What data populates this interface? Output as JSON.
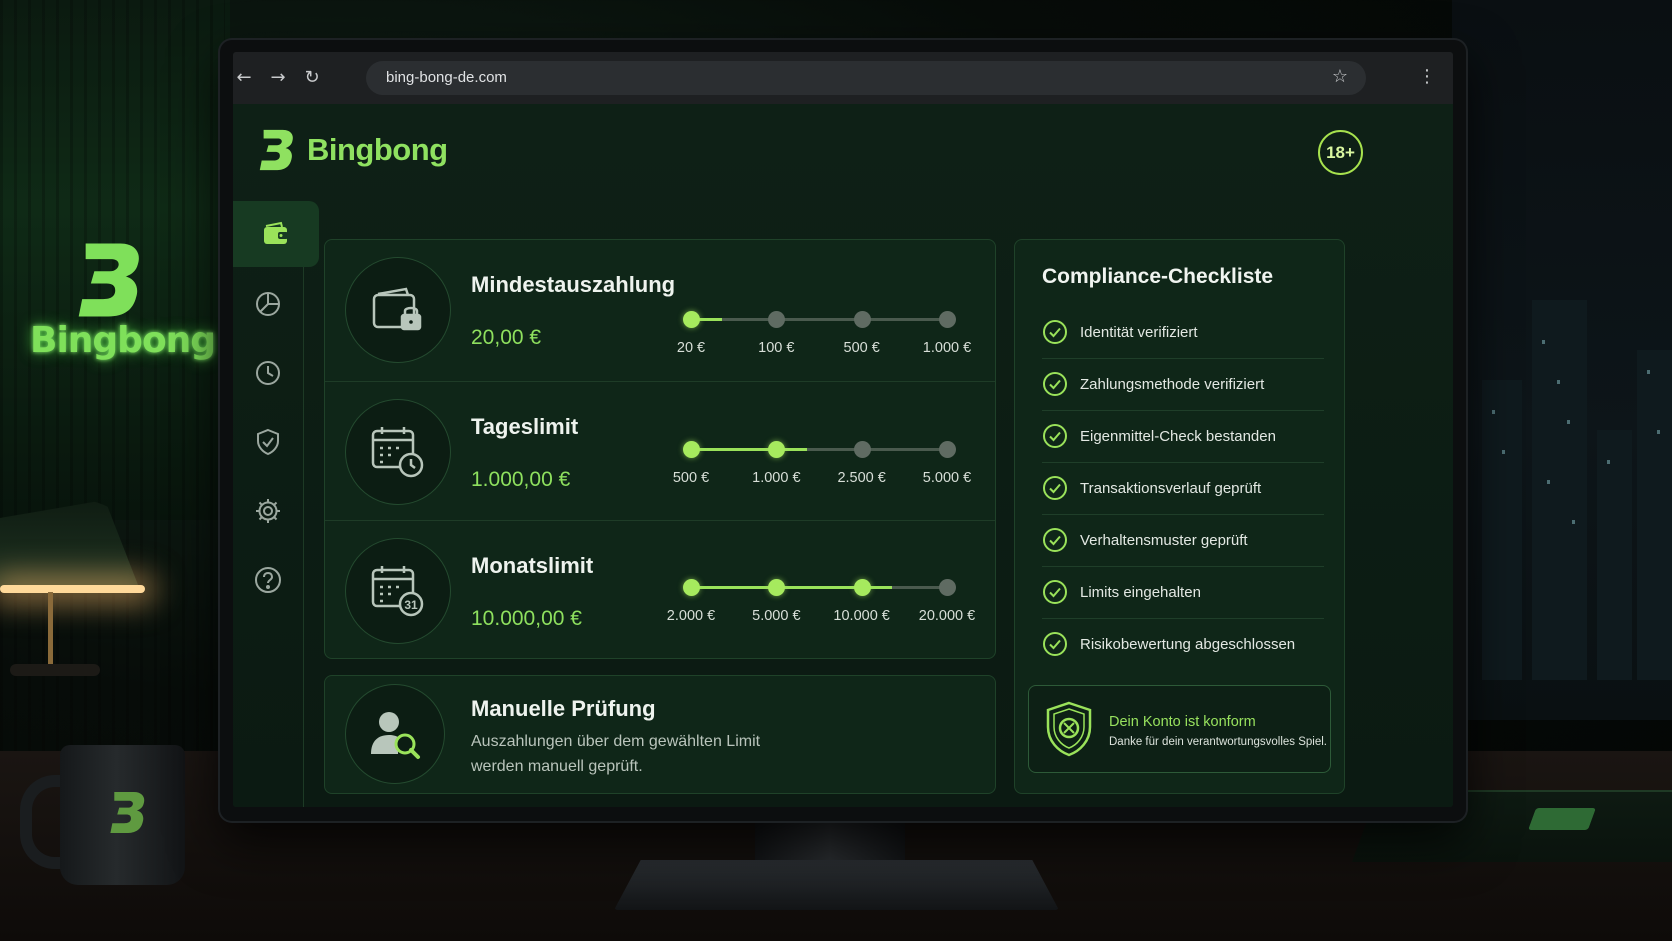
{
  "browser": {
    "url": "bing-bong-de.com",
    "back_icon": "arrow-left-icon",
    "forward_icon": "arrow-right-icon",
    "reload_icon": "reload-icon",
    "bookmark_icon": "star-icon",
    "menu_icon": "kebab-menu-icon"
  },
  "brand": {
    "name": "Bingbong",
    "accent_color": "#8fe160",
    "age_badge": "18+"
  },
  "sidebar": {
    "items": [
      {
        "icon": "wallet-icon",
        "active": true
      },
      {
        "icon": "pie-chart-icon",
        "active": false
      },
      {
        "icon": "clock-icon",
        "active": false
      },
      {
        "icon": "shield-check-icon",
        "active": false
      },
      {
        "icon": "gear-icon",
        "active": false
      },
      {
        "icon": "help-icon",
        "active": false
      }
    ]
  },
  "limits": [
    {
      "title": "Mindestauszahlung",
      "value": "20,00 €",
      "icon": "wallet-lock-icon",
      "steps": [
        "20 €",
        "100 €",
        "500 €",
        "1.000 €"
      ],
      "selected_index": 0
    },
    {
      "title": "Tageslimit",
      "value": "1.000,00 €",
      "icon": "calendar-clock-icon",
      "steps": [
        "500 €",
        "1.000 €",
        "2.500 €",
        "5.000 €"
      ],
      "selected_index": 1
    },
    {
      "title": "Monatslimit",
      "value": "10.000,00 €",
      "icon": "calendar-31-icon",
      "steps": [
        "2.000 €",
        "5.000 €",
        "10.000 €",
        "20.000 €"
      ],
      "selected_index": 2
    }
  ],
  "review": {
    "title": "Manuelle Prüfung",
    "description": "Auszahlungen über dem gewählten Limit werden manuell geprüft.",
    "icon": "user-search-icon"
  },
  "checklist": {
    "title": "Compliance-Checkliste",
    "items": [
      "Identität verifiziert",
      "Zahlungsmethode verifiziert",
      "Eigenmittel-Check bestanden",
      "Transaktionsverlauf geprüft",
      "Verhaltensmuster geprüft",
      "Limits eingehalten",
      "Risikobewertung abgeschlossen"
    ],
    "status_title": "Dein Konto ist konform",
    "status_subtitle": "Danke für dein verantwortungsvolles Spiel.",
    "status_icon": "shield-badge-icon"
  },
  "scene": {
    "wall_logo_text": "Bingbong"
  }
}
